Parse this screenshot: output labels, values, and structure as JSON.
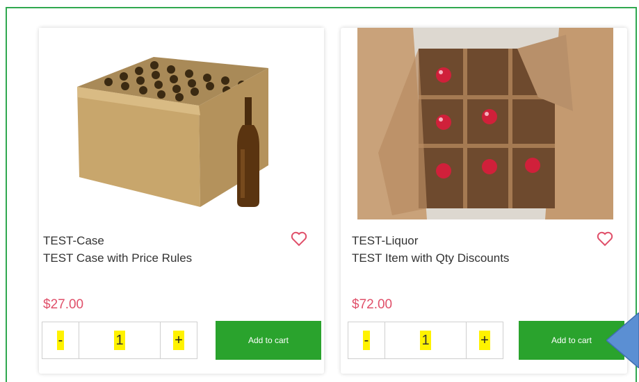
{
  "products": [
    {
      "code": "TEST-Case",
      "name": "TEST Case with Price Rules",
      "price": "$27.00",
      "qty_minus": "-",
      "qty_value": "1",
      "qty_plus": "+",
      "add_label": "Add to cart"
    },
    {
      "code": "TEST-Liquor",
      "name": "TEST Item with Qty Discounts",
      "price": "$72.00",
      "qty_minus": "-",
      "qty_value": "1",
      "qty_plus": "+",
      "add_label": "Add to cart"
    }
  ],
  "colors": {
    "frame": "#2fa84f",
    "price": "#e0506a",
    "heart": "#e0506a",
    "button": "#2aa32d",
    "highlight": "#fff200",
    "arrow": "#5b8fd3"
  },
  "icons": [
    "heart-icon",
    "product-image-case",
    "product-image-liquor",
    "callout-arrow"
  ]
}
